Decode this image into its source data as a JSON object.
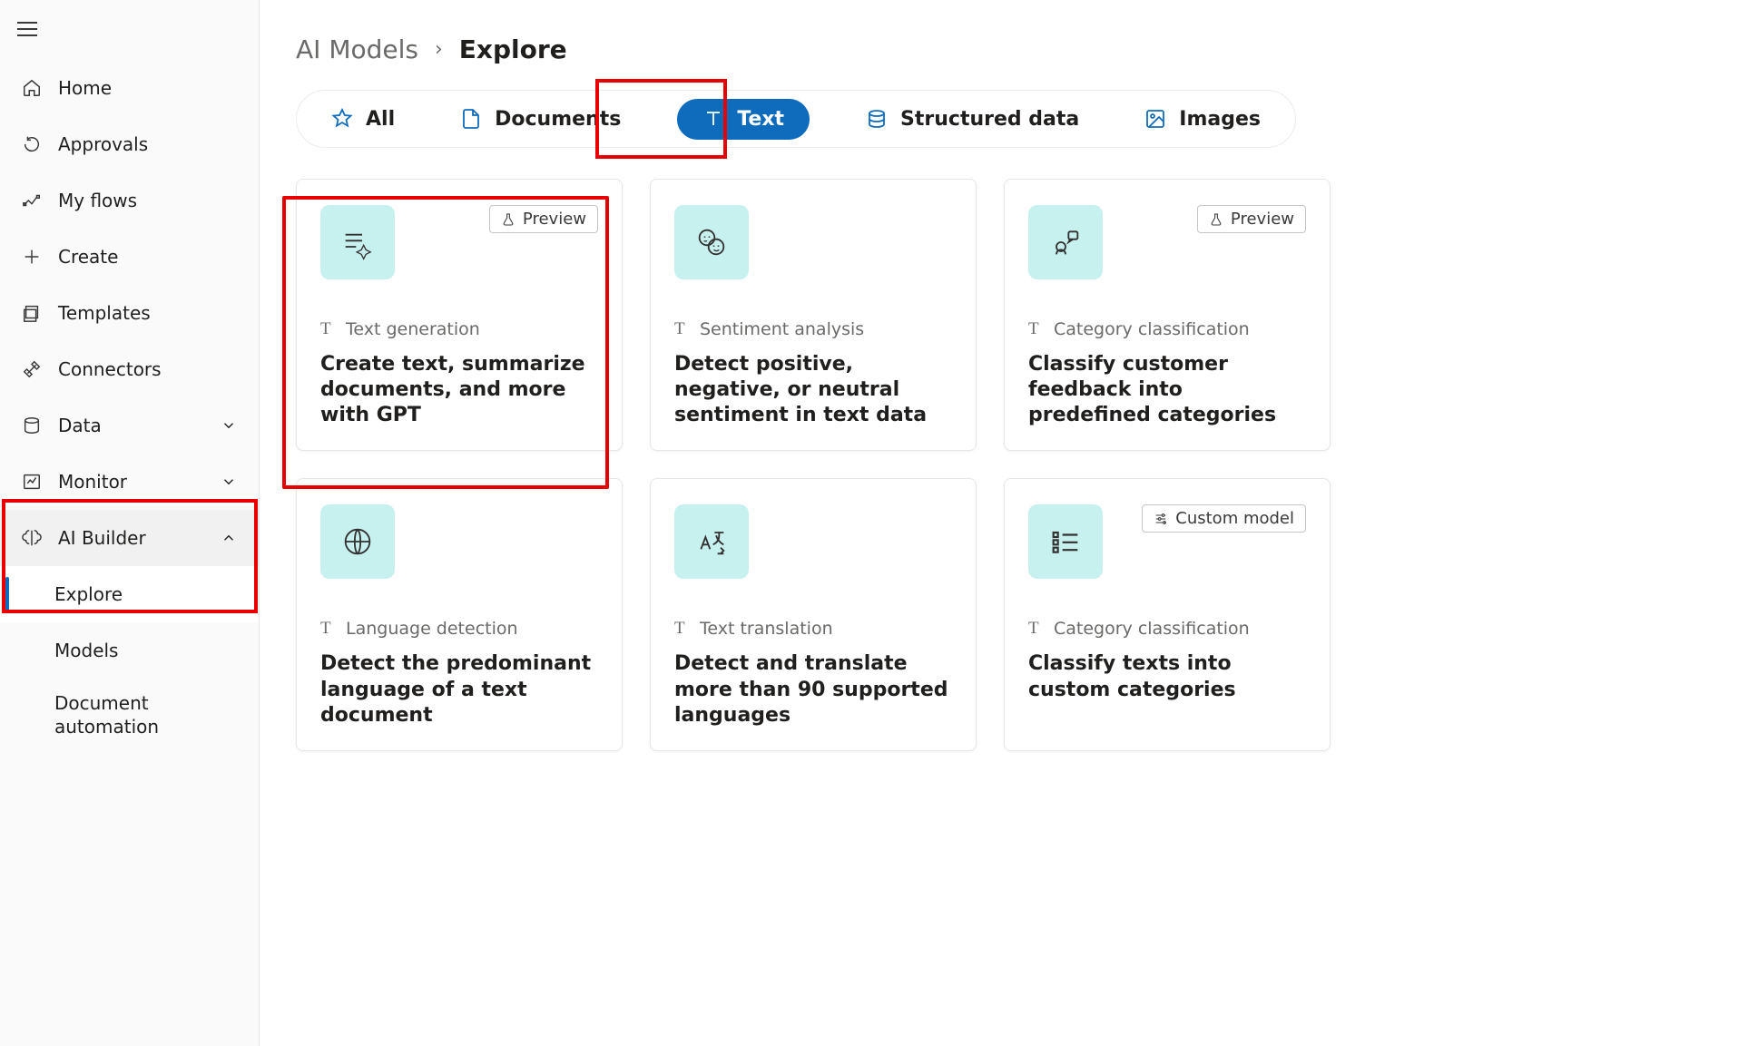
{
  "sidebar": {
    "items": [
      {
        "label": "Home"
      },
      {
        "label": "Approvals"
      },
      {
        "label": "My flows"
      },
      {
        "label": "Create"
      },
      {
        "label": "Templates"
      },
      {
        "label": "Connectors"
      },
      {
        "label": "Data"
      },
      {
        "label": "Monitor"
      },
      {
        "label": "AI Builder"
      }
    ],
    "aiBuilderChildren": [
      {
        "label": "Explore"
      },
      {
        "label": "Models"
      },
      {
        "label": "Document automation"
      }
    ]
  },
  "breadcrumb": {
    "parent": "AI Models",
    "current": "Explore"
  },
  "filters": [
    {
      "label": "All"
    },
    {
      "label": "Documents"
    },
    {
      "label": "Text"
    },
    {
      "label": "Structured data"
    },
    {
      "label": "Images"
    }
  ],
  "cards": [
    {
      "badge": "Preview",
      "category": "Text generation",
      "title": "Create text, summarize documents, and more with GPT"
    },
    {
      "category": "Sentiment analysis",
      "title": "Detect positive, negative, or neutral sentiment in text data"
    },
    {
      "badge": "Preview",
      "category": "Category classification",
      "title": "Classify customer feedback into predefined categories"
    },
    {
      "category": "Language detection",
      "title": "Detect the predominant language of a text document"
    },
    {
      "category": "Text translation",
      "title": "Detect and translate more than 90 supported languages"
    },
    {
      "badge": "Custom model",
      "badgeIcon": "sliders",
      "category": "Category classification",
      "title": "Classify texts into custom categories"
    }
  ],
  "categoryPrefix": "T"
}
